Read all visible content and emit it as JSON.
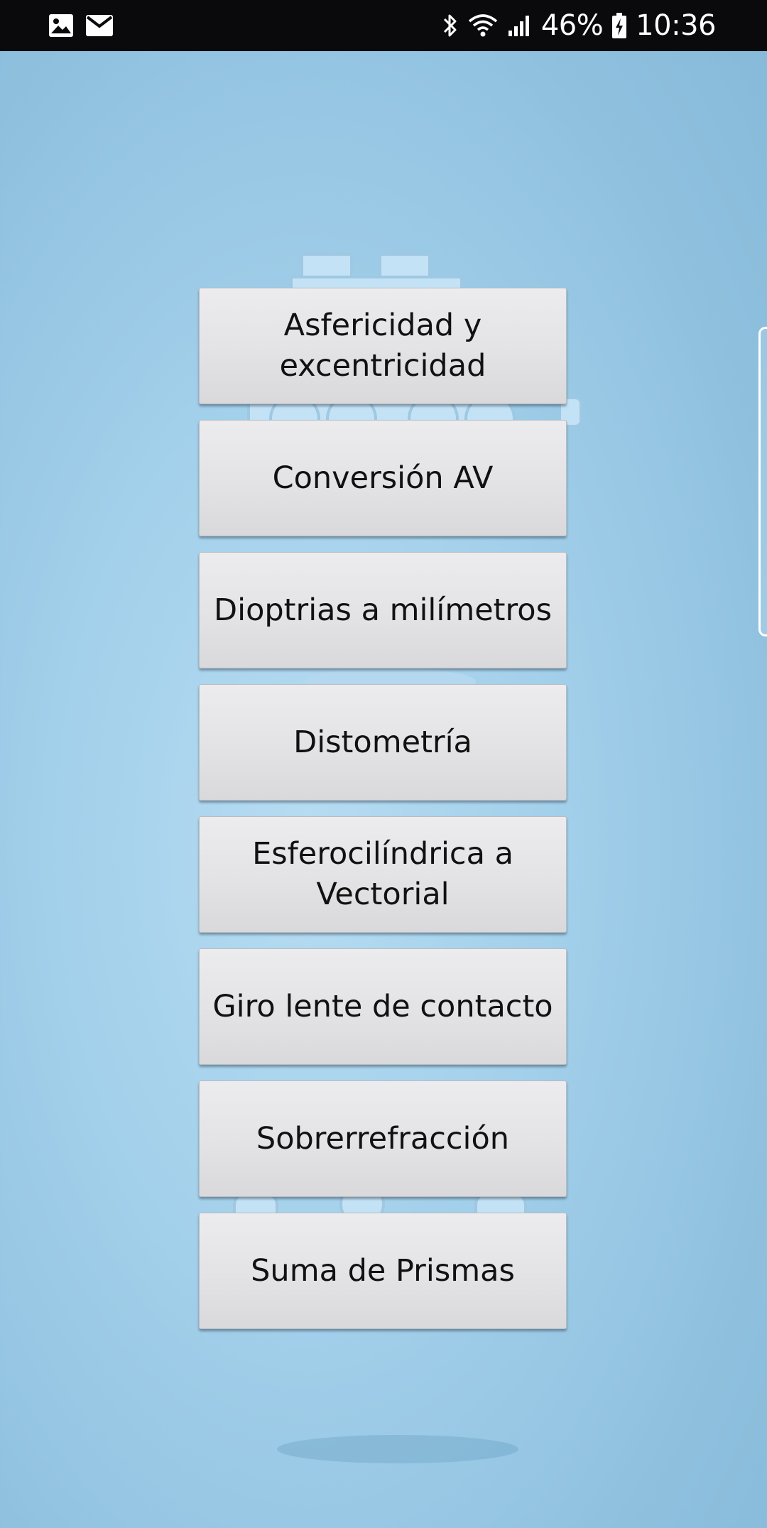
{
  "status_bar": {
    "battery": "46%",
    "time": "10:36",
    "left_icons": [
      "image-icon",
      "mail-icon"
    ],
    "right_icons": [
      "bluetooth-icon",
      "wifi-icon",
      "signal-icon",
      "battery-charging-icon"
    ]
  },
  "menu": {
    "items": [
      {
        "label": "Asfericidad y excentricidad"
      },
      {
        "label": "Conversión AV"
      },
      {
        "label": "Dioptrias a milímetros"
      },
      {
        "label": "Distometría"
      },
      {
        "label": "Esferocilíndrica a Vectorial"
      },
      {
        "label": "Giro lente de contacto"
      },
      {
        "label": "Sobrerrefracción"
      },
      {
        "label": "Suma de Prismas"
      }
    ]
  },
  "colors": {
    "status_bar": "#0a0a0c",
    "background": "#a2cfea",
    "button_face": "#e3e3e6",
    "button_text": "#111111"
  }
}
